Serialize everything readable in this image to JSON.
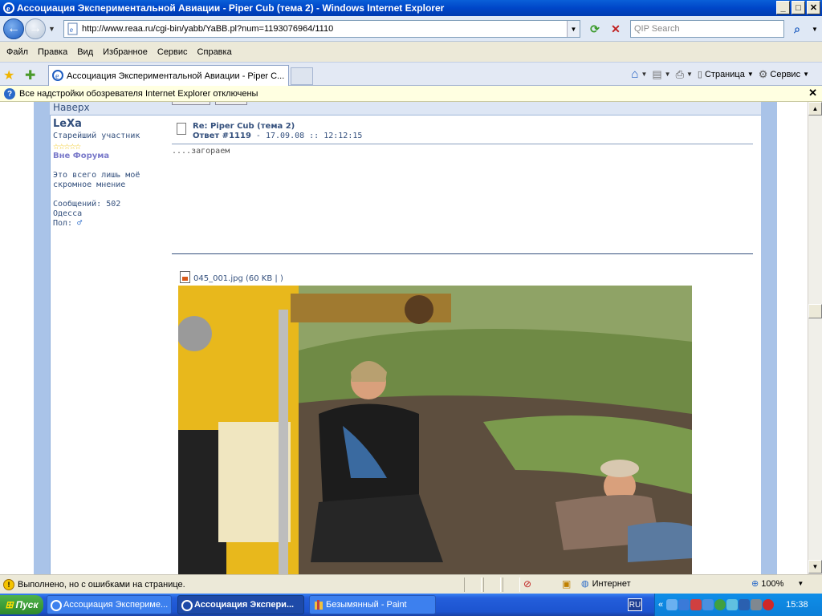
{
  "window": {
    "title": "Ассоциация Экспериментальной Авиации - Piper Cub (тема 2) - Windows Internet Explorer"
  },
  "address": {
    "url": "http://www.reaa.ru/cgi-bin/yabb/YaBB.pl?num=1193076964/1110",
    "search_placeholder": "QIP Search"
  },
  "menu": [
    "Файл",
    "Правка",
    "Вид",
    "Избранное",
    "Сервис",
    "Справка"
  ],
  "tab": {
    "label": "Ассоциация Экспериментальной Авиации - Piper C..."
  },
  "toolbar": {
    "page_label": "Страница",
    "tools_label": "Сервис"
  },
  "infobar": {
    "text": "Все надстройки обозревателя Internet Explorer отключены"
  },
  "forum": {
    "back_link": "Наверх",
    "author": {
      "nick": "LeXa",
      "rank": "Старейший участник",
      "stars": "☆☆☆☆☆",
      "status": "Вне Форума",
      "signature_line1": "Это всего лишь моё",
      "signature_line2": "скромное мнение",
      "posts": "Сообщений: 502",
      "city": "Одесса",
      "gender": "Пол:"
    },
    "post": {
      "title": "Re: Piper Cub (тема 2)",
      "reply": "Ответ #1119",
      "date": " - 17.09.08 :: 12:12:15",
      "text": "....загораем"
    },
    "attachment": "045_001.jpg (60 KB | )"
  },
  "status": {
    "text": "Выполнено, но с ошибками на странице.",
    "zone": "Интернет",
    "zoom": "100%"
  },
  "taskbar": {
    "start": "Пуск",
    "items": [
      "Ассоциация Экспериме...",
      "Ассоциация Экспери...",
      "Безымянный - Paint"
    ],
    "lang": "RU",
    "clock": "15:38"
  }
}
